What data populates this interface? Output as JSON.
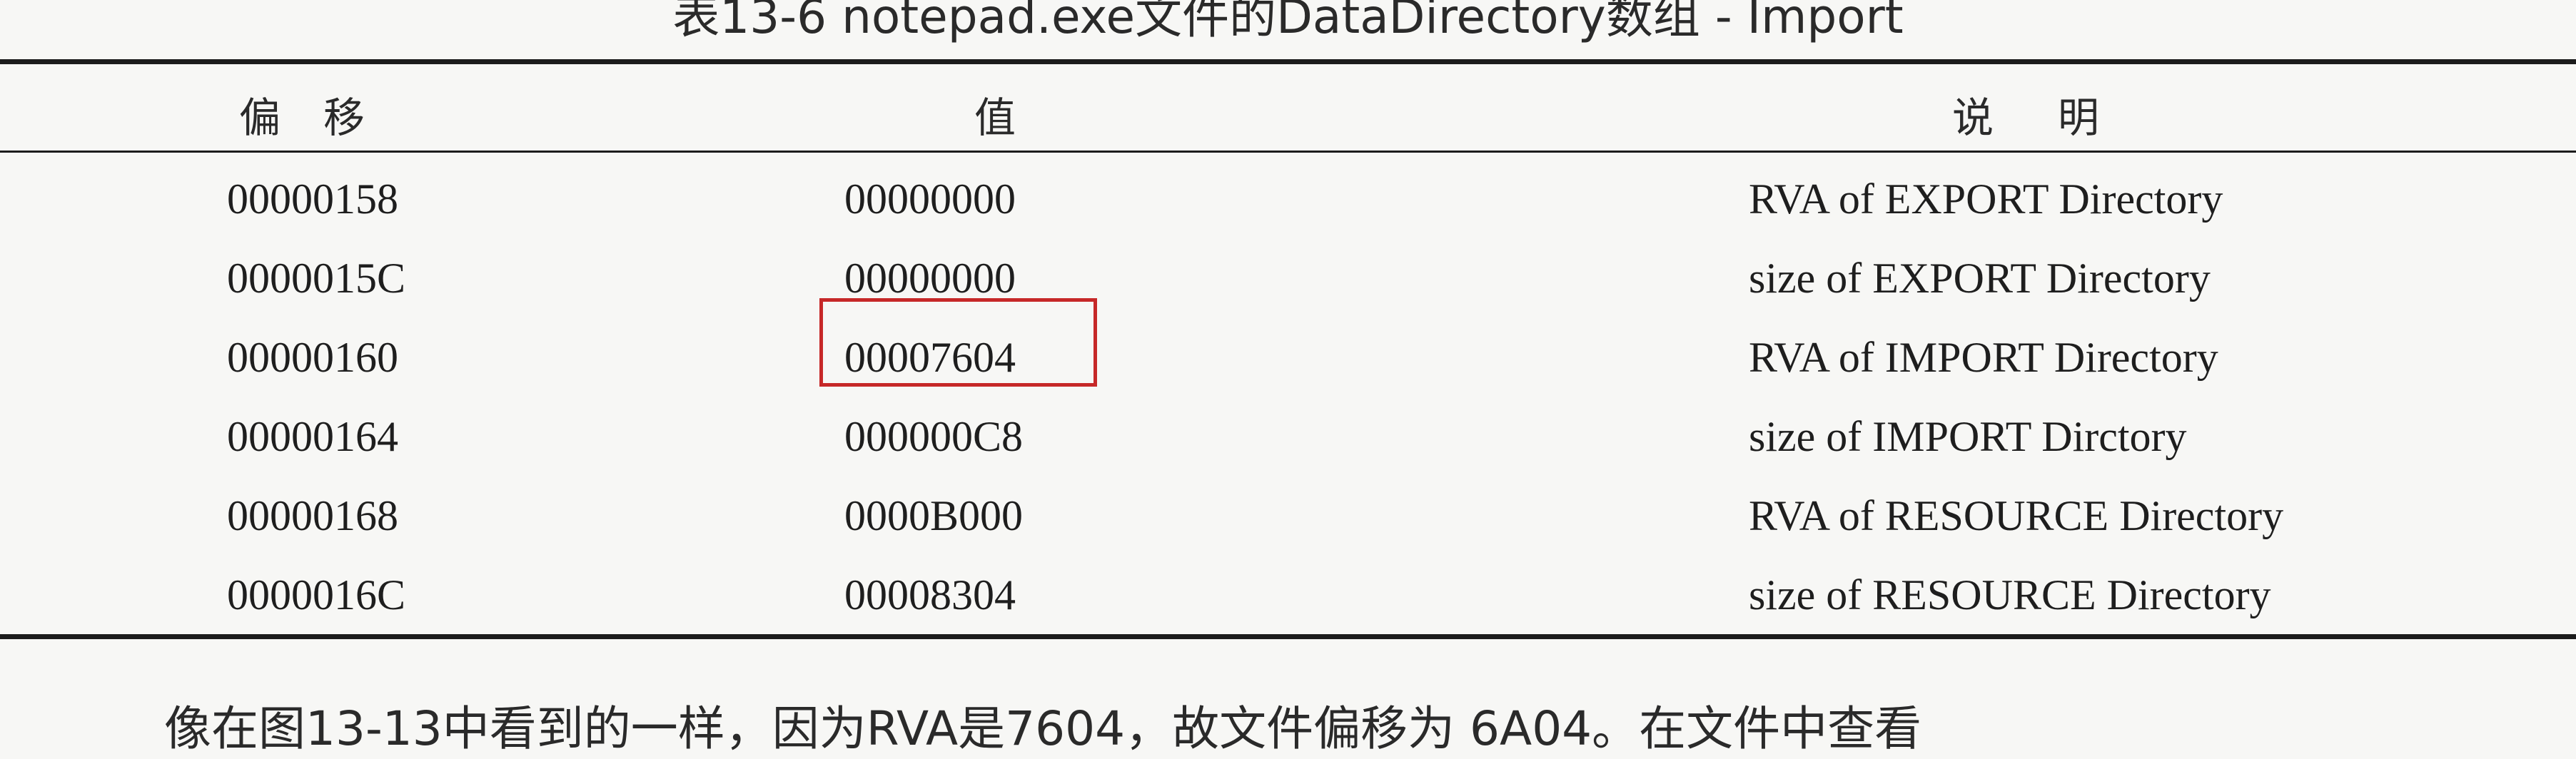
{
  "caption": "表13-6   notepad.exe文件的DataDirectory数组 - Import",
  "table": {
    "headers": [
      "偏移",
      "值",
      "说明"
    ],
    "rows": [
      {
        "offset": "00000158",
        "value": "00000000",
        "desc": "RVA of EXPORT Directory"
      },
      {
        "offset": "0000015C",
        "value": "00000000",
        "desc": "size of EXPORT Directory"
      },
      {
        "offset": "00000160",
        "value": "00007604",
        "desc": "RVA of IMPORT Directory"
      },
      {
        "offset": "00000164",
        "value": "000000C8",
        "desc": "size of IMPORT Dirctory"
      },
      {
        "offset": "00000168",
        "value": "0000B000",
        "desc": "RVA of RESOURCE Directory"
      },
      {
        "offset": "0000016C",
        "value": "00008304",
        "desc": "size of RESOURCE Directory"
      }
    ],
    "highlight_color": "#c62828"
  },
  "body_text": "像在图13-13中看到的一样，因为RVA是7604，故文件偏移为 6A04。在文件中查看"
}
